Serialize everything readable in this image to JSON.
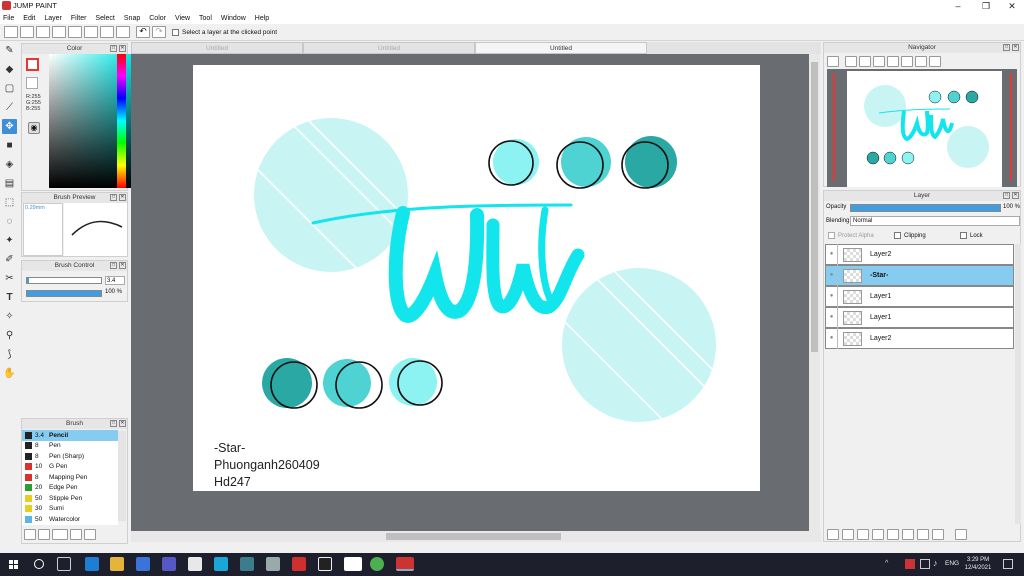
{
  "window": {
    "title": "JUMP PAINT"
  },
  "menu": [
    "File",
    "Edit",
    "Layer",
    "Filter",
    "Select",
    "Snap",
    "Color",
    "View",
    "Tool",
    "Window",
    "Help"
  ],
  "toolbar": {
    "select_layer_label": "Select a layer at the clicked point"
  },
  "color_panel": {
    "title": "Color",
    "r": "R:255",
    "g": "G:255",
    "b": "B:255",
    "accent": "#00e5e5"
  },
  "brush_preview": {
    "title": "Brush Preview",
    "size": "0.29mm"
  },
  "brush_control": {
    "title": "Brush Control",
    "size_value": "3.4",
    "opacity_value": "100 %"
  },
  "brush_list": {
    "title": "Brush",
    "items": [
      {
        "size": "3.4",
        "name": "Pencil",
        "color": "#222222"
      },
      {
        "size": "8",
        "name": "Pen",
        "color": "#222222"
      },
      {
        "size": "8",
        "name": "Pen (Sharp)",
        "color": "#222222"
      },
      {
        "size": "10",
        "name": "G Pen",
        "color": "#d93030"
      },
      {
        "size": "8",
        "name": "Mapping Pen",
        "color": "#d93030"
      },
      {
        "size": "20",
        "name": "Edge Pen",
        "color": "#2aa02a"
      },
      {
        "size": "50",
        "name": "Stipple Pen",
        "color": "#e6cf20"
      },
      {
        "size": "30",
        "name": "Sumi",
        "color": "#e6cf20"
      },
      {
        "size": "50",
        "name": "Watercolor",
        "color": "#5ab4e6"
      }
    ]
  },
  "doc_tabs": [
    "Untitled",
    "Untitled",
    "Untitled"
  ],
  "canvas_text": {
    "line1": "-Star-",
    "line2": "Phuonganh260409",
    "line3": "Hd247"
  },
  "navigator": {
    "title": "Navigator"
  },
  "layer_panel": {
    "title": "Layer",
    "opacity_label": "Opacity",
    "opacity_value": "100 %",
    "blending_label": "Blending",
    "blending_value": "Normal",
    "protect_alpha": "Protect Alpha",
    "clipping": "Clipping",
    "lock": "Lock",
    "layers": [
      {
        "name": "Layer2"
      },
      {
        "name": "-Star-"
      },
      {
        "name": "Layer1"
      },
      {
        "name": "Layer1"
      },
      {
        "name": "Layer2"
      }
    ]
  },
  "taskbar": {
    "time": "3:29 PM",
    "date": "12/4/2021",
    "lang": "ENG"
  }
}
